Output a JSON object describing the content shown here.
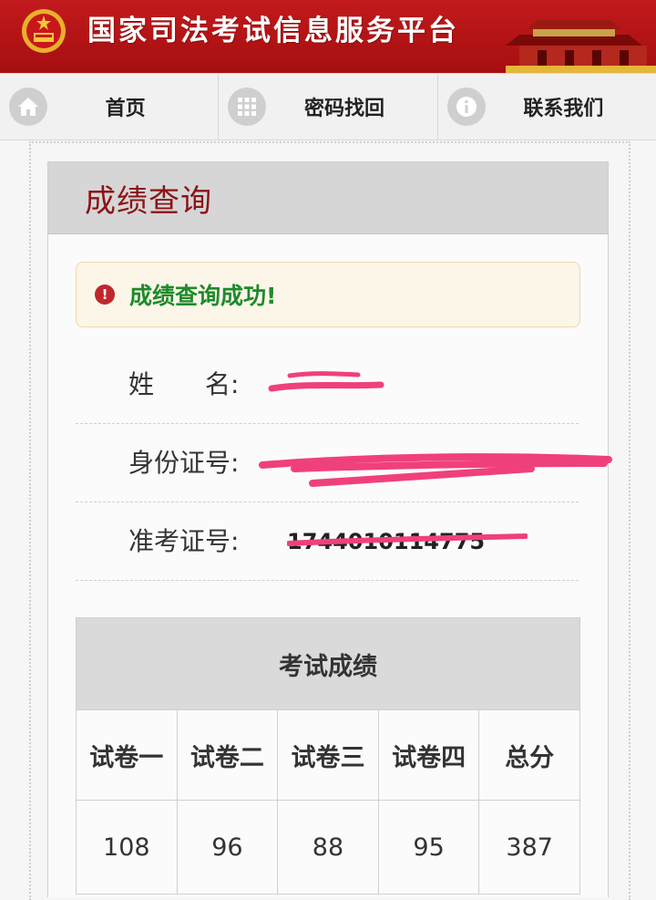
{
  "header": {
    "title": "国家司法考试信息服务平台",
    "emblem_icon": "national-emblem-icon",
    "background_color": "#b81517"
  },
  "nav": {
    "items": [
      {
        "label": "首页",
        "icon": "home-icon"
      },
      {
        "label": "密码找回",
        "icon": "grid-icon"
      },
      {
        "label": "联系我们",
        "icon": "info-icon"
      }
    ]
  },
  "panel": {
    "title": "成绩查询",
    "alert": {
      "text": "成绩查询成功!",
      "icon": "alert-icon",
      "color": "#1f8a2a"
    },
    "info": [
      {
        "label": "姓　　名:",
        "value": "[redacted]"
      },
      {
        "label": "身份证号:",
        "value": "[redacted]"
      },
      {
        "label": "准考证号:",
        "value": "1744010114775"
      }
    ]
  },
  "scores": {
    "caption": "考试成绩",
    "headers": [
      "试卷一",
      "试卷二",
      "试卷三",
      "试卷四",
      "总分"
    ],
    "values": [
      "108",
      "96",
      "88",
      "95",
      "387"
    ]
  }
}
